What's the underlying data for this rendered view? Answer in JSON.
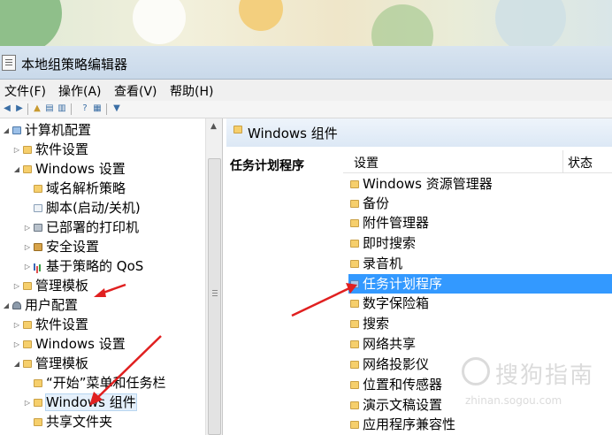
{
  "window": {
    "title": "本地组策略编辑器"
  },
  "menu": [
    {
      "label": "文件(F)"
    },
    {
      "label": "操作(A)"
    },
    {
      "label": "查看(V)"
    },
    {
      "label": "帮助(H)"
    }
  ],
  "tree": {
    "items": [
      {
        "label": "计算机配置",
        "icon": "computer-icon",
        "expander": "open"
      },
      {
        "label": "软件设置",
        "icon": "folder-icon",
        "expander": "collapsed"
      },
      {
        "label": "Windows 设置",
        "icon": "folder-icon",
        "expander": "open"
      },
      {
        "label": "域名解析策略",
        "icon": "folder-icon",
        "expander": "none"
      },
      {
        "label": "脚本(启动/关机)",
        "icon": "document-icon",
        "expander": "none"
      },
      {
        "label": "已部署的打印机",
        "icon": "printer-icon",
        "expander": "collapsed"
      },
      {
        "label": "安全设置",
        "icon": "security-icon",
        "expander": "collapsed"
      },
      {
        "label": "基于策略的 QoS",
        "icon": "chart-icon",
        "expander": "collapsed"
      },
      {
        "label": "管理模板",
        "icon": "folder-icon",
        "expander": "collapsed"
      },
      {
        "label": "用户配置",
        "icon": "user-icon",
        "expander": "open"
      },
      {
        "label": "软件设置",
        "icon": "folder-icon",
        "expander": "collapsed"
      },
      {
        "label": "Windows 设置",
        "icon": "folder-icon",
        "expander": "collapsed"
      },
      {
        "label": "管理模板",
        "icon": "folder-icon",
        "expander": "open"
      },
      {
        "label": "“开始”菜单和任务栏",
        "icon": "folder-icon",
        "expander": "none"
      },
      {
        "label": "Windows 组件",
        "icon": "folder-icon",
        "expander": "collapsed",
        "selected": true
      },
      {
        "label": "共享文件夹",
        "icon": "folder-icon",
        "expander": "none"
      }
    ]
  },
  "right": {
    "header": "Windows 组件",
    "description_title": "任务计划程序",
    "columns": {
      "setting": "设置",
      "status": "状态"
    },
    "items": [
      {
        "label": "Windows 资源管理器"
      },
      {
        "label": "备份"
      },
      {
        "label": "附件管理器"
      },
      {
        "label": "即时搜索"
      },
      {
        "label": "录音机"
      },
      {
        "label": "任务计划程序",
        "selected": true
      },
      {
        "label": "数字保险箱"
      },
      {
        "label": "搜索"
      },
      {
        "label": "网络共享"
      },
      {
        "label": "网络投影仪"
      },
      {
        "label": "位置和传感器"
      },
      {
        "label": "演示文稿设置"
      },
      {
        "label": "应用程序兼容性"
      }
    ]
  },
  "watermark": {
    "brand": "搜狗指南",
    "url": "zhinan.sogou.com"
  },
  "colors": {
    "selection": "#3399ff",
    "arrow": "#e02020",
    "folder": "#f6cf6c"
  }
}
